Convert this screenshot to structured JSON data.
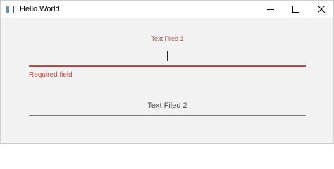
{
  "window": {
    "title": "Hello World"
  },
  "form": {
    "field1": {
      "floating_label": "Text Filed 1",
      "value": "",
      "error": "Required field"
    },
    "field2": {
      "placeholder": "Text Filed 2",
      "value": ""
    }
  },
  "icons": {
    "app": "app-window-icon",
    "minimize": "minimize-icon",
    "maximize": "maximize-icon",
    "close": "close-icon"
  },
  "colors": {
    "error": "#c0504d",
    "focus_underline": "#b34a47",
    "underline": "#7a7a7a",
    "background": "#f2f2f2"
  }
}
